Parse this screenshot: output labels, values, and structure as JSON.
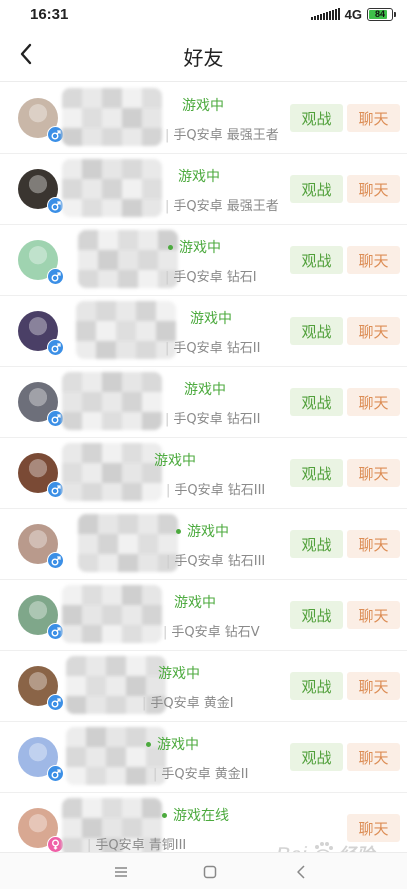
{
  "status_bar": {
    "time": "16:31",
    "network": "4G",
    "battery": "84",
    "battery_level": 0.84
  },
  "header": {
    "title": "好友",
    "back_icon": "chevron-left-icon"
  },
  "friends": [
    {
      "status": "游戏中",
      "info": "手Q安卓 最强王者",
      "watch": "观战",
      "chat": "聊天",
      "gender": "male",
      "avatar_color": "#c9b7a8"
    },
    {
      "status": "游戏中",
      "info": "手Q安卓 最强王者",
      "watch": "观战",
      "chat": "聊天",
      "gender": "male",
      "avatar_color": "#3a3530"
    },
    {
      "status": "游戏中",
      "info": "手Q安卓 钻石I",
      "watch": "观战",
      "chat": "聊天",
      "gender": "male",
      "avatar_color": "#9fd3b0"
    },
    {
      "status": "游戏中",
      "info": "手Q安卓 钻石II",
      "watch": "观战",
      "chat": "聊天",
      "gender": "male",
      "avatar_color": "#4a3f66"
    },
    {
      "status": "游戏中",
      "info": "手Q安卓 钻石II",
      "watch": "观战",
      "chat": "聊天",
      "gender": "male",
      "avatar_color": "#6d6f7a"
    },
    {
      "status": "游戏中",
      "info": "手Q安卓 钻石III",
      "watch": "观战",
      "chat": "聊天",
      "gender": "male",
      "avatar_color": "#7a4a35"
    },
    {
      "status": "游戏中",
      "info": "手Q安卓 钻石III",
      "watch": "观战",
      "chat": "聊天",
      "gender": "male",
      "avatar_color": "#b99a8c"
    },
    {
      "status": "游戏中",
      "info": "手Q安卓 钻石V",
      "watch": "观战",
      "chat": "聊天",
      "gender": "male",
      "avatar_color": "#7fa78a"
    },
    {
      "status": "游戏中",
      "info": "手Q安卓 黄金I",
      "watch": "观战",
      "chat": "聊天",
      "gender": "male",
      "avatar_color": "#8a6447"
    },
    {
      "status": "游戏中",
      "info": "手Q安卓 黄金II",
      "watch": "观战",
      "chat": "聊天",
      "gender": "male",
      "avatar_color": "#9fb8e6"
    },
    {
      "status": "游戏在线",
      "info": "手Q安卓 青铜III",
      "watch": "",
      "chat": "聊天",
      "gender": "female",
      "avatar_color": "#d8a892"
    }
  ],
  "nav_bar": {
    "menu_icon": "menu-icon",
    "home_icon": "home-square-icon",
    "back_icon": "back-triangle-icon"
  },
  "watermark": {
    "text": "Bai du 经验"
  },
  "colors": {
    "accent_green": "#4caa3e",
    "watch_bg": "#eaf4e3",
    "chat_bg": "#fbeee5",
    "chat_text": "#dc8d55",
    "male_badge": "#3b8fe6",
    "female_badge": "#ef5fa6"
  }
}
